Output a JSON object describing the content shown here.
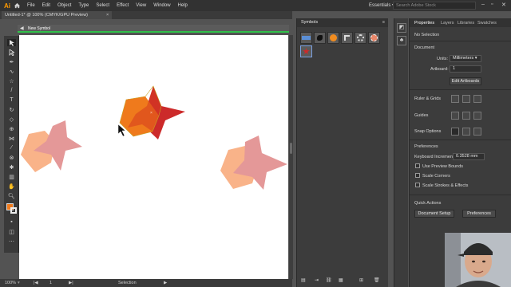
{
  "app": {
    "logo": "Ai"
  },
  "menu": [
    "File",
    "Edit",
    "Object",
    "Type",
    "Select",
    "Effect",
    "View",
    "Window",
    "Help"
  ],
  "workspace": "Essentials",
  "search": {
    "placeholder": "Search Adobe Stock"
  },
  "document": {
    "tab_title": "Untitled-1* @ 100% (CMYK/GPU Preview)",
    "close": "×"
  },
  "isolation": {
    "symbol_name": "New Symbol"
  },
  "status": {
    "zoom": "100%",
    "artboard": "1",
    "tool": "Selection"
  },
  "symbols_panel": {
    "title": "Symbols"
  },
  "properties": {
    "tabs": [
      "Properties",
      "Layers",
      "Libraries",
      "Swatches"
    ],
    "selection": "No Selection",
    "document_label": "Document",
    "units_label": "Units:",
    "units_value": "Millimeters",
    "artboard_label": "Artboard:",
    "artboard_value": "1",
    "edit_artboards": "Edit Artboards",
    "ruler_grids": "Ruler & Grids",
    "guides": "Guides",
    "snap_options": "Snap Options",
    "preferences_label": "Preferences",
    "keyboard_increment_label": "Keyboard Increment:",
    "keyboard_increment_value": "0.3528 mm",
    "use_preview_bounds": "Use Preview Bounds",
    "scale_corners": "Scale Corners",
    "scale_strokes": "Scale Strokes & Effects",
    "quick_actions": "Quick Actions",
    "document_setup": "Document Setup",
    "preferences_button": "Preferences"
  },
  "colors": {
    "accent_orange": "#ff9a00",
    "isolation_green": "#30c04a",
    "star_red": "#cc2a2a",
    "hexagon_orange": "#ef7a1c",
    "star_pink": "#e49898",
    "hexagon_peach": "#f9b389"
  }
}
